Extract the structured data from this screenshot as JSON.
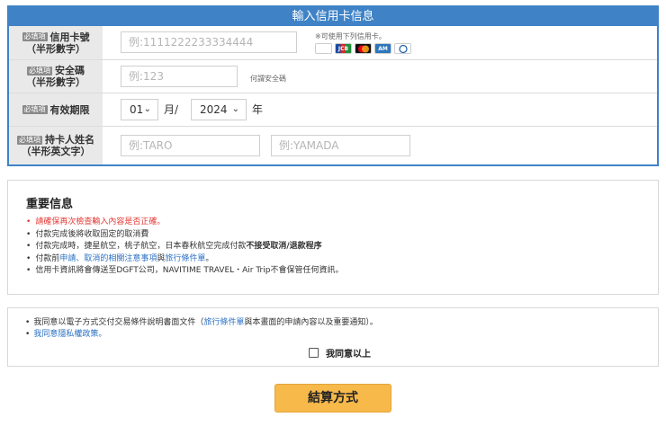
{
  "form": {
    "title": "輸入信用卡信息",
    "required_badge": "必填項",
    "card_number": {
      "label": "信用卡號",
      "sublabel": "（半形數字）",
      "placeholder": "例:1111222233334444",
      "note": "※可使用下列信用卡。",
      "card_logos": [
        "VISA",
        "JCB",
        "MC",
        "AMEX",
        "DC"
      ]
    },
    "security_code": {
      "label": "安全碼",
      "sublabel": "（半形數字）",
      "placeholder": "例:123",
      "hint": "何謂安全碼"
    },
    "expiry": {
      "label": "有效期限",
      "month": "01",
      "month_unit": "月/",
      "year": "2024",
      "year_unit": "年"
    },
    "cardholder": {
      "label": "持卡人姓名",
      "sublabel": "（半形英文字）",
      "first_placeholder": "例:TARO",
      "last_placeholder": "例:YAMADA"
    }
  },
  "info": {
    "title": "重要信息",
    "item1": "請確保再次檢查輸入內容是否正確。",
    "item2": "付款完成後將收取固定的取消費",
    "item3_pre": "付款完成時，捷星航空，桃子航空，日本春秋航空完成付款",
    "item3_bold": "不接受取消/退款程序",
    "item4_pre": "付款前",
    "item4_link1": "申請、取消的相關注意事項",
    "item4_mid": "與",
    "item4_link2": "旅行條件單",
    "item4_post": "。",
    "item5": "信用卡資訊將會傳送至DGFT公司，NAVITIME TRAVEL・Air Trip不會保管任何資訊。"
  },
  "consent": {
    "line1_pre": "我同意以電子方式交付交易條件說明書面文件（",
    "line1_link": "旅行條件單",
    "line1_post": "與本畫面的申請內容以及重要通知）。",
    "line2_link": "我同意隱私權政策。",
    "agree_label": "我同意以上"
  },
  "submit_label": "結算方式"
}
